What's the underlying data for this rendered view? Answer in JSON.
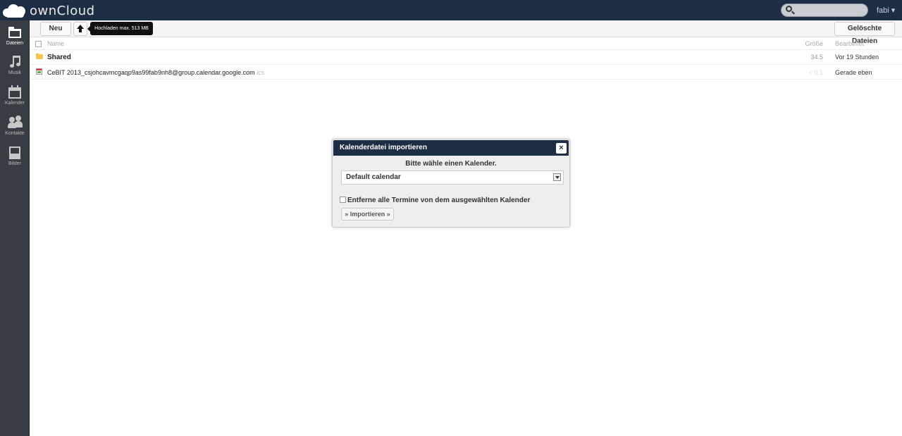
{
  "header": {
    "logo_text": "ownCloud",
    "search_placeholder": "",
    "user": "fabi ▾"
  },
  "nav": {
    "items": [
      {
        "label": "Dateien",
        "icon": "folder-icon"
      },
      {
        "label": "Musik",
        "icon": "music-icon"
      },
      {
        "label": "Kalender",
        "icon": "calendar-icon"
      },
      {
        "label": "Kontakte",
        "icon": "contacts-icon"
      },
      {
        "label": "Bilder",
        "icon": "picture-icon"
      }
    ]
  },
  "controls": {
    "new_label": "Neu",
    "upload_icon": "upload-icon",
    "upload_tooltip": "Hochladen max. 513 MB",
    "deleted_label": "Gelöschte Dateien"
  },
  "table": {
    "columns": {
      "name": "Name",
      "size": "Größe",
      "modified": "Bearbeitet"
    },
    "rows": [
      {
        "name": "Shared",
        "ext": "",
        "size": "34.5",
        "modified": "Vor 19 Stunden",
        "type": "folder"
      },
      {
        "name": "CeBIT 2013_csjohcavmcgaqp9as99fab9nh8@group.calendar.google.com",
        "ext": "ics",
        "size": "< 0.1",
        "modified": "Gerade eben",
        "type": "calendar-file"
      }
    ]
  },
  "dialog": {
    "title": "Kalenderdatei importieren",
    "close": "×",
    "prompt": "Bitte wähle einen Kalender.",
    "selected_calendar": "Default calendar",
    "checkbox_label": "Entferne alle Termine von dem ausgewählten Kalender",
    "import_label": "» Importieren »"
  },
  "colors": {
    "header_bg": "#1d2d44",
    "nav_bg": "#383c43",
    "folder_color": "#f2c94c"
  }
}
